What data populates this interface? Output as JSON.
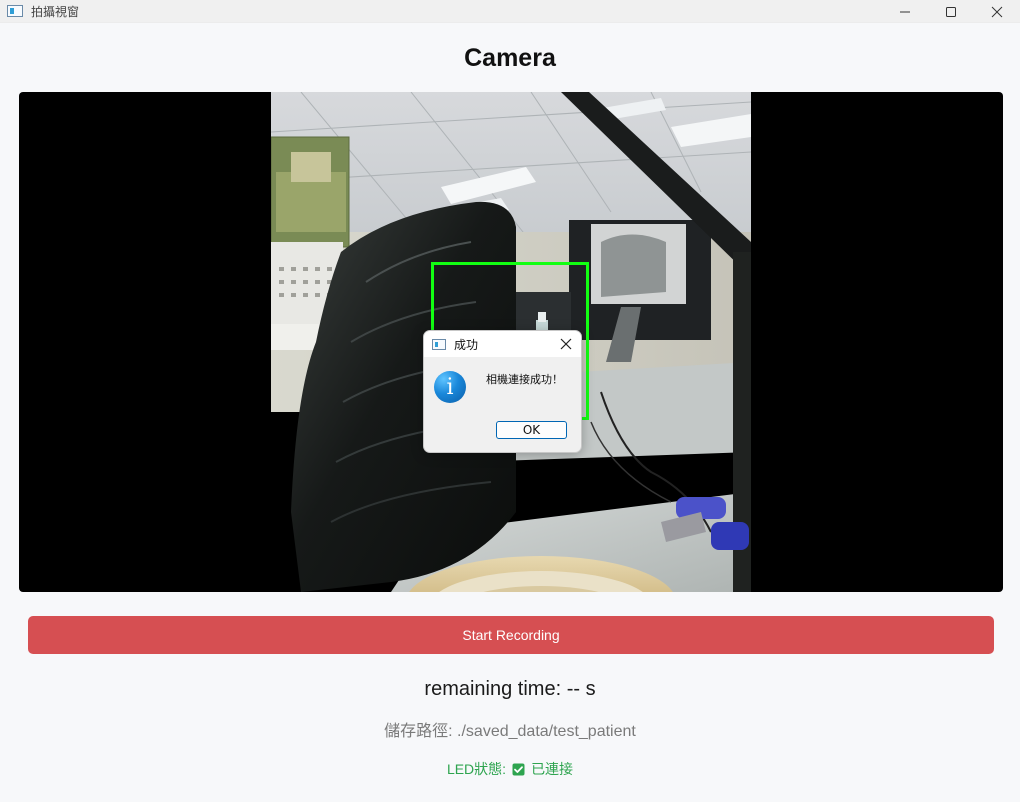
{
  "window": {
    "title": "拍攝視窗",
    "minimize_icon": "minimize-icon",
    "maximize_icon": "maximize-icon",
    "close_icon": "close-icon"
  },
  "header": {
    "title": "Camera"
  },
  "dialog": {
    "title": "成功",
    "message": "相機連接成功！",
    "ok_label": "OK",
    "icon": "info-icon"
  },
  "controls": {
    "record_label": "Start Recording",
    "remaining_time": "remaining time: -- s",
    "save_path": "儲存路徑: ./saved_data/test_patient",
    "led_label": "LED狀態:",
    "led_value": "已連接"
  },
  "colors": {
    "record_button": "#d64f52",
    "detection_box": "#12ff12",
    "led_text": "#2ea44f"
  }
}
